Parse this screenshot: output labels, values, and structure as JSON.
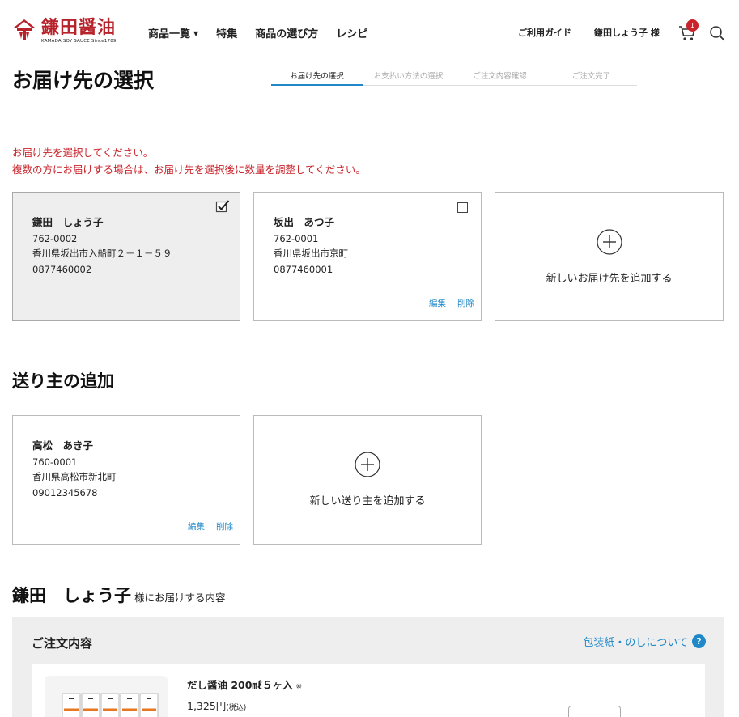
{
  "brand": {
    "logo_kanji": "鎌田醤油",
    "logo_sub": "KAMADA SOY SAUCE Since1789",
    "accent": "#b8232b",
    "link_color": "#1e88c8",
    "error_color": "#c9242b"
  },
  "nav": {
    "items": [
      "商品一覧",
      "特集",
      "商品の選び方",
      "レシピ"
    ]
  },
  "header": {
    "guide": "ご利用ガイド",
    "user": "鎌田しょう子 様",
    "cart_count": "1"
  },
  "page": {
    "title": "お届け先の選択"
  },
  "steps": [
    {
      "label": "お届け先の選択",
      "active": true
    },
    {
      "label": "お支払い方法の選択",
      "active": false
    },
    {
      "label": "ご注文内容確認",
      "active": false
    },
    {
      "label": "ご注文完了",
      "active": false
    }
  ],
  "instructions": [
    "お届け先を選択してください。",
    "複数の方にお届けする場合は、お届け先を選択後に数量を調整してください。"
  ],
  "destinations": [
    {
      "name": "鎌田　しょう子",
      "zip": "762-0002",
      "address": "香川県坂出市入船町２－１－５９",
      "phone": "0877460002",
      "selected": true
    },
    {
      "name": "坂出　あつ子",
      "zip": "762-0001",
      "address": "香川県坂出市京町",
      "phone": "0877460001",
      "selected": false,
      "edit": "編集",
      "delete": "削除"
    }
  ],
  "add_destination": "新しいお届け先を追加する",
  "sender_section": {
    "title": "送り主の追加",
    "senders": [
      {
        "name": "高松　あき子",
        "zip": "760-0001",
        "address": "香川県高松市新北町",
        "phone": "09012345678",
        "edit": "編集",
        "delete": "削除"
      }
    ],
    "add_sender": "新しい送り主を追加する"
  },
  "recipient": {
    "name": "鎌田　しょう子",
    "suffix": "様にお届けする内容"
  },
  "order": {
    "title": "ご注文内容",
    "wrap_link": "包装紙・のしについて",
    "items": [
      {
        "name": "だし醤油 200㎖５ヶ入",
        "note": "※",
        "price": "1,325円",
        "tax": "(税込)"
      }
    ]
  }
}
